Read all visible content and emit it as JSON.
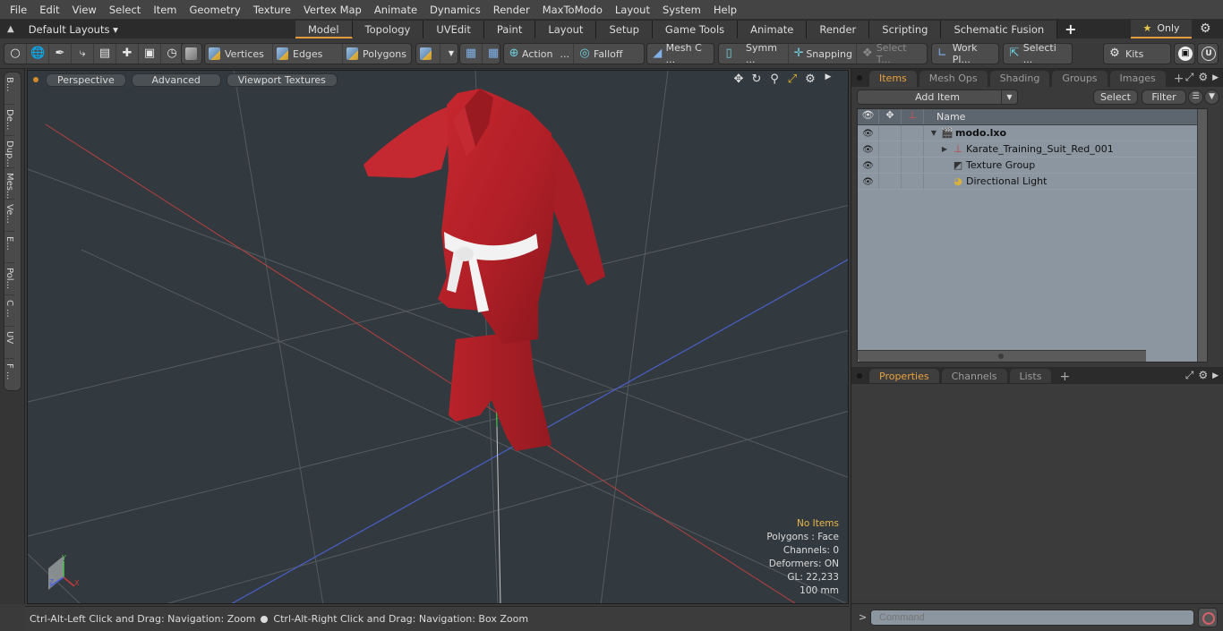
{
  "menu": [
    "File",
    "Edit",
    "View",
    "Select",
    "Item",
    "Geometry",
    "Texture",
    "Vertex Map",
    "Animate",
    "Dynamics",
    "Render",
    "MaxToModo",
    "Layout",
    "System",
    "Help"
  ],
  "layout_bar": {
    "layout_selector": "Default Layouts ▾",
    "tabs": [
      "Model",
      "Topology",
      "UVEdit",
      "Paint",
      "Layout",
      "Setup",
      "Game Tools",
      "Animate",
      "Render",
      "Scripting",
      "Schematic Fusion"
    ],
    "active_tab": "Model",
    "add_tab": "+",
    "only_label": "Only",
    "accent_color": "#e29a3c"
  },
  "toolbar": {
    "selection_modes": [
      "Vertices",
      "Edges",
      "Polygons"
    ],
    "action": "Action",
    "action_more": "...",
    "falloff": "Falloff",
    "mesh_constraint": "Mesh C ...",
    "symmetry": "Symm ...",
    "snapping": "Snapping",
    "select_through": "Select T...",
    "work_plane": "Work Pl...",
    "selection_sets": "Selecti ...",
    "kits": "Kits"
  },
  "left_strip": [
    "B...",
    "De...",
    "Dup...",
    "Mes...",
    "Ve...",
    "E...",
    "Pol...",
    "C ...",
    "UV",
    "F ..."
  ],
  "viewport": {
    "view_mode": "Perspective",
    "shading": "Advanced",
    "textures": "Viewport Textures",
    "info": {
      "selection": "No Items",
      "polygons": "Polygons : Face",
      "channels": "Channels: 0",
      "deformers": "Deformers: ON",
      "gl": "GL: 22,233",
      "unit": "100 mm"
    },
    "axes": {
      "x": "X",
      "y": "Y",
      "z": "Z"
    },
    "model_colors": {
      "suit": "#b8212a",
      "belt": "#f0f0f0"
    }
  },
  "status": {
    "hint_left": "Ctrl-Alt-Left Click and Drag: Navigation: Zoom",
    "hint_right": "Ctrl-Alt-Right Click and Drag: Navigation: Box Zoom"
  },
  "items_panel": {
    "tabs": [
      "Items",
      "Mesh Ops",
      "Shading",
      "Groups",
      "Images"
    ],
    "active_tab": "Items",
    "add_item": "Add Item",
    "select": "Select",
    "filter": "Filter",
    "column_name": "Name",
    "rows": [
      {
        "name": "modo.lxo",
        "icon": "scene-icon",
        "expander": "▼",
        "bold": true,
        "indent": 0
      },
      {
        "name": "Karate_Training_Suit_Red_001",
        "icon": "mesh-locator-icon",
        "expander": "▶",
        "bold": false,
        "indent": 1
      },
      {
        "name": "Texture Group",
        "icon": "texture-group-icon",
        "expander": "",
        "bold": false,
        "indent": 1
      },
      {
        "name": "Directional Light",
        "icon": "light-icon",
        "expander": "",
        "bold": false,
        "indent": 1
      }
    ]
  },
  "properties_panel": {
    "tabs": [
      "Properties",
      "Channels",
      "Lists"
    ],
    "active_tab": "Properties"
  },
  "command": {
    "prompt": ">",
    "placeholder": "Command"
  }
}
